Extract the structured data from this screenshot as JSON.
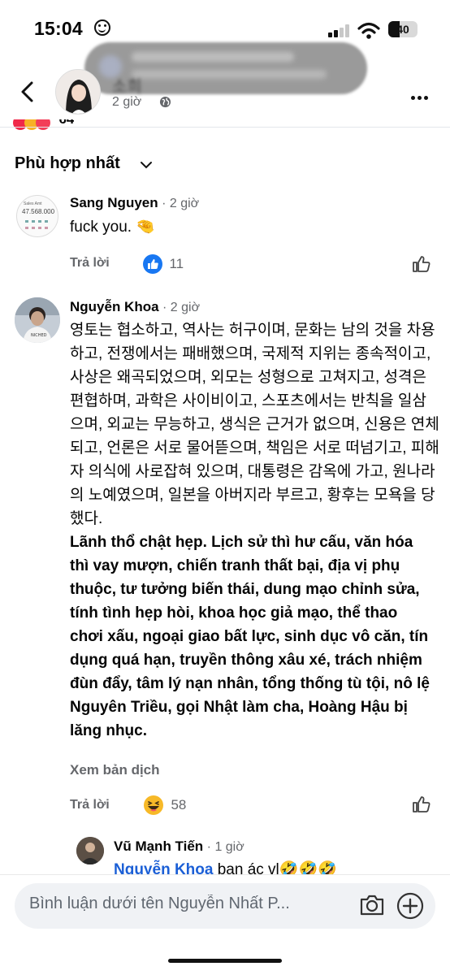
{
  "status_bar": {
    "time": "15:04",
    "battery": "40"
  },
  "header": {
    "time": "2 giờ"
  },
  "post_reactions": {
    "count": "64"
  },
  "sort": {
    "label": "Phù hợp nhất"
  },
  "comments": [
    {
      "name": "Sang Nguyen",
      "time": "2 giờ",
      "text": "fuck you. 🤏",
      "avatar_text": "47.568.000",
      "reply_label": "Trả lời",
      "reaction_count": "11"
    },
    {
      "name": "Nguyễn Khoa",
      "time": "2 giờ",
      "text": "영토는 협소하고, 역사는 허구이며, 문화는 남의 것을 차용하고, 전쟁에서는 패배했으며, 국제적 지위는 종속적이고, 사상은 왜곡되었으며, 외모는 성형으로 고쳐지고, 성격은 편협하며, 과학은 사이비이고, 스포츠에서는 반칙을 일삼으며, 외교는 무능하고, 생식은 근거가 없으며, 신용은 연체되고, 언론은 서로 물어뜯으며, 책임은 서로 떠넘기고, 피해자 의식에 사로잡혀 있으며, 대통령은 감옥에 가고, 원나라의 노예였으며, 일본을 아버지라 부르고, 황후는 모욕을 당했다.",
      "text_vi": "Lãnh thổ chật hẹp. Lịch sử thì hư cấu, văn hóa thì vay mượn, chiến tranh thất bại, địa vị phụ thuộc, tư tưởng biến thái, dung mạo chỉnh sửa, tính tình hẹp hòi, khoa học giả mạo, thể thao chơi xấu, ngoại giao bất lực, sinh dục vô căn, tín dụng quá hạn, truyền thông xâu xé, trách nhiệm đùn đẩy, tâm lý nạn nhân, tổng thống tù tội, nô lệ Nguyên Triều, gọi Nhật làm cha, Hoàng Hậu bị lăng nhục.",
      "translate_label": "Xem bản dịch",
      "reply_label": "Trả lời",
      "reaction_count": "58"
    },
    {
      "name": "Vũ Mạnh Tiến",
      "time": "1 giờ",
      "mention": "Nguyễn Khoa",
      "text": "bạn ác vl🤣🤣🤣"
    }
  ],
  "composer": {
    "placeholder": "Bình luận dưới tên Nguyễn Nhất P..."
  },
  "colors": {
    "accent": "#1877f2",
    "mention": "#1b5fd6",
    "muted": "#65676b"
  },
  "icons": [
    "back-icon",
    "globe-icon",
    "more-icon",
    "chevron-down-icon",
    "thumbs-up-icon",
    "laugh-emoji-icon",
    "camera-icon",
    "plus-icon"
  ]
}
